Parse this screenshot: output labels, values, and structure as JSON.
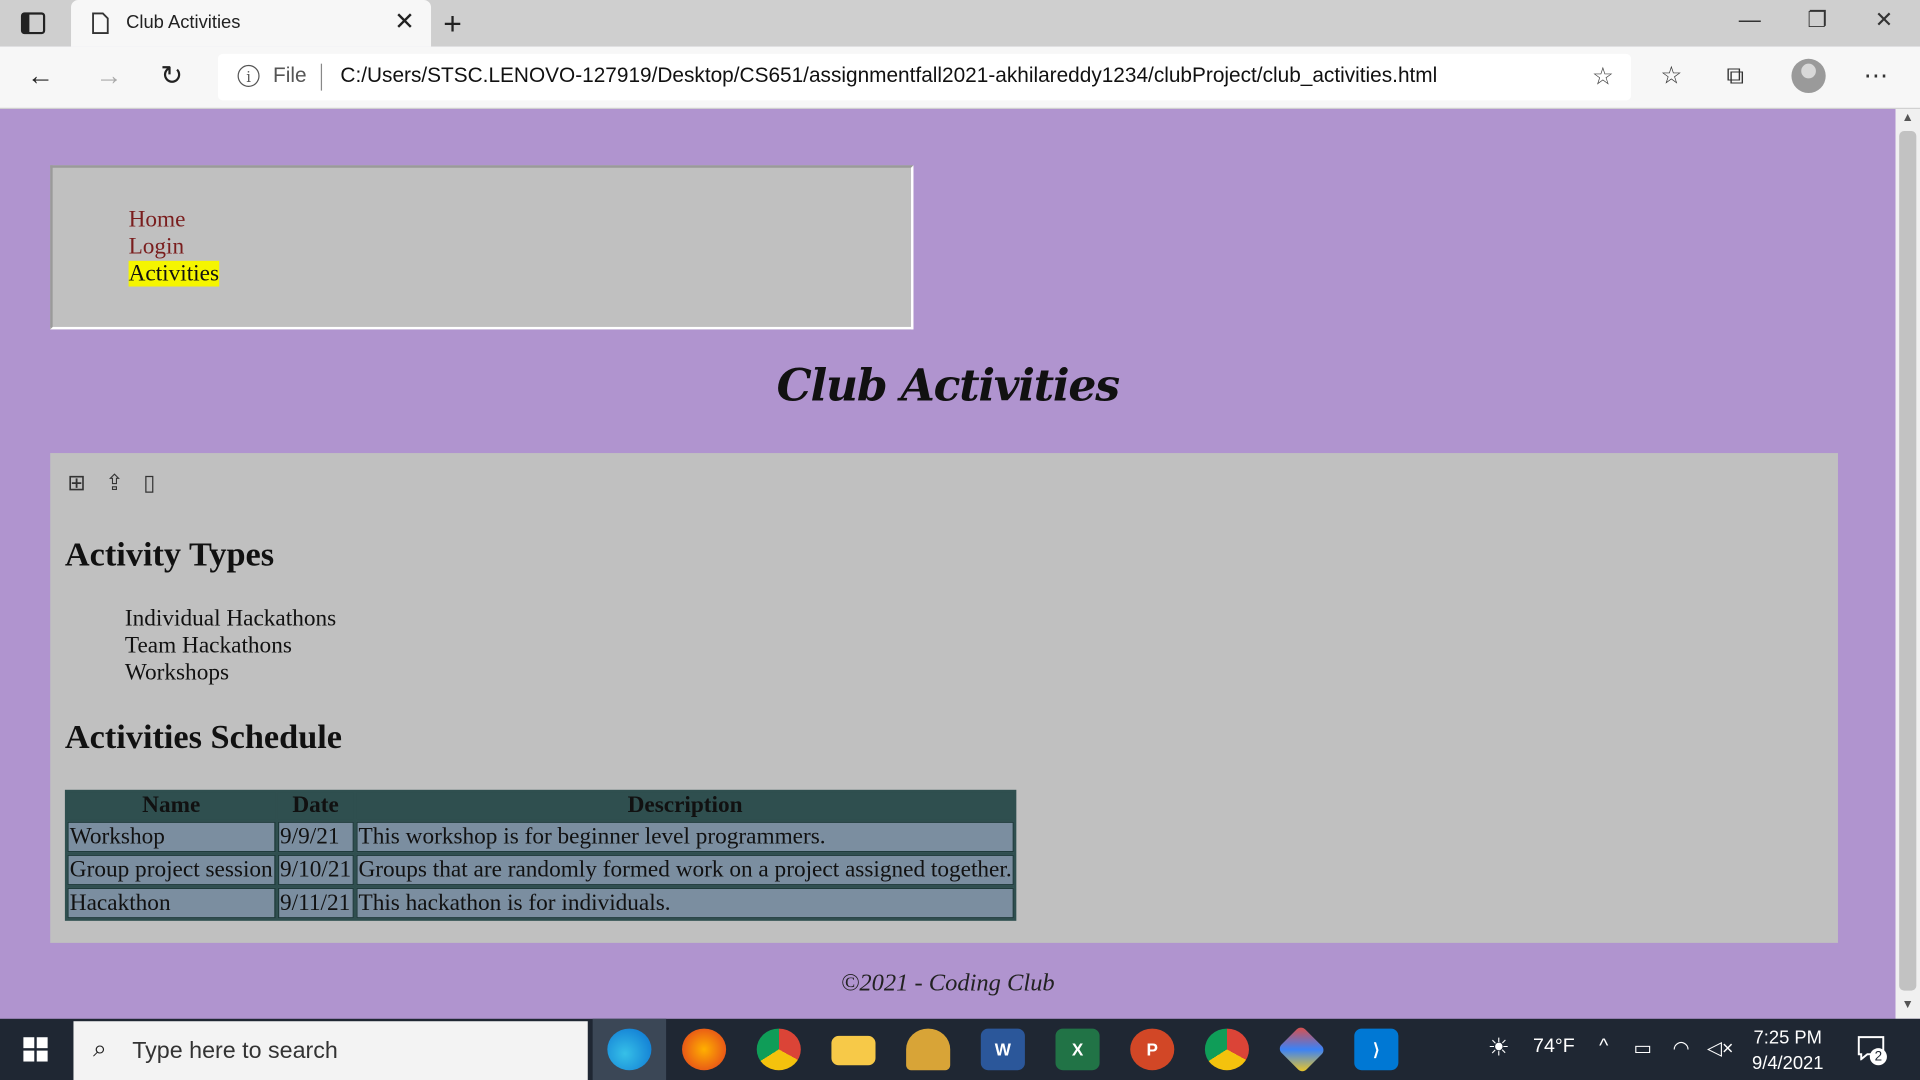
{
  "browser": {
    "tab_title": "Club Activities",
    "address_prefix": "File",
    "url": "C:/Users/STSC.LENOVO-127919/Desktop/CS651/assignmentfall2021-akhilareddy1234/clubProject/club_activities.html"
  },
  "nav": {
    "items": [
      {
        "label": "Home",
        "active": false
      },
      {
        "label": "Login",
        "active": false
      },
      {
        "label": "Activities",
        "active": true
      }
    ]
  },
  "page": {
    "title": "Club Activities",
    "activity_types_heading": "Activity Types",
    "activity_types": [
      "Individual Hackathons",
      "Team Hackathons",
      "Workshops"
    ],
    "schedule_heading": "Activities Schedule",
    "schedule": {
      "headers": [
        "Name",
        "Date",
        "Description"
      ],
      "rows": [
        [
          "Workshop",
          "9/9/21",
          "This workshop is for beginner level programmers."
        ],
        [
          "Group project session",
          "9/10/21",
          "Groups that are randomly formed work on a project assigned together."
        ],
        [
          "Hacakthon",
          "9/11/21",
          "This hackathon is for individuals."
        ]
      ]
    },
    "footer": "©2021 - Coding Club"
  },
  "taskbar": {
    "search_placeholder": "Type here to search",
    "weather": "74°F",
    "time": "7:25 PM",
    "date": "9/4/2021",
    "notification_count": "2"
  },
  "colors": {
    "page_background": "#b094cf",
    "panel_background": "#c0c0c0",
    "table_border": "#2f4f4f",
    "table_cell": "#7b8ea0",
    "nav_link": "#7a1e1e",
    "active_highlight": "#f5f500"
  }
}
